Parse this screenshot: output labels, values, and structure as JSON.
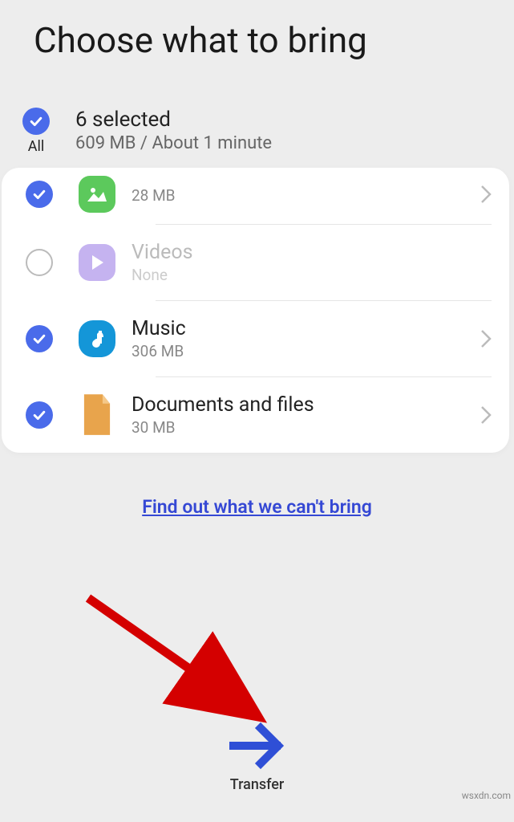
{
  "title": "Choose what to bring",
  "summary": {
    "all_label": "All",
    "count_text": "6 selected",
    "size_text": "609 MB / About 1 minute"
  },
  "items": [
    {
      "title": "",
      "subtitle": "28 MB",
      "checked": true,
      "icon": "image",
      "disabled": false
    },
    {
      "title": "Videos",
      "subtitle": "None",
      "checked": false,
      "icon": "video",
      "disabled": true
    },
    {
      "title": "Music",
      "subtitle": "306 MB",
      "checked": true,
      "icon": "music",
      "disabled": false
    },
    {
      "title": "Documents and files",
      "subtitle": "30 MB",
      "checked": true,
      "icon": "doc",
      "disabled": false
    }
  ],
  "info_link": "Find out what we can't bring",
  "transfer_label": "Transfer",
  "watermark": "wsxdn.com"
}
